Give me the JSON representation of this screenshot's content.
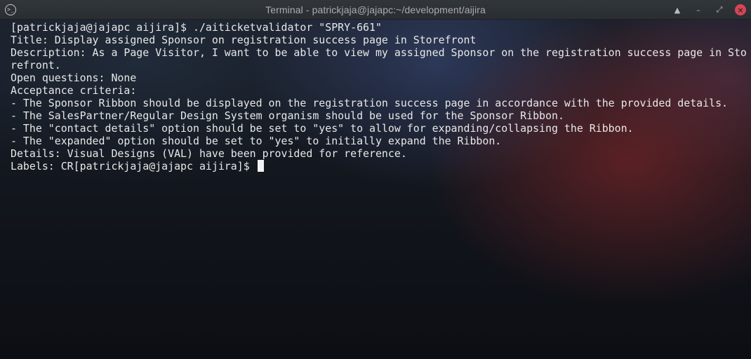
{
  "window": {
    "title": "Terminal - patrickjaja@jajapc:~/development/aijira",
    "app_icon": "terminal-app-icon",
    "controls": {
      "keep_above_icon": "▲",
      "minimize_icon": "–",
      "maximize_icon": "⤢",
      "close_icon": "×"
    }
  },
  "terminal": {
    "lines": [
      "[patrickjaja@jajapc aijira]$ ./aiticketvalidator \"SPRY-661\"",
      "Title: Display assigned Sponsor on registration success page in Storefront",
      "Description: As a Page Visitor, I want to be able to view my assigned Sponsor on the registration success page in Sto",
      "refront.",
      "Open questions: None",
      "Acceptance criteria:",
      "- The Sponsor Ribbon should be displayed on the registration success page in accordance with the provided details.",
      "- The SalesPartner/Regular Design System organism should be used for the Sponsor Ribbon.",
      "- The \"contact details\" option should be set to \"yes\" to allow for expanding/collapsing the Ribbon.",
      "- The \"expanded\" option should be set to \"yes\" to initially expand the Ribbon.",
      "Details: Visual Designs (VAL) have been provided for reference.",
      "Labels: CR[patrickjaja@jajapc aijira]$ "
    ]
  }
}
